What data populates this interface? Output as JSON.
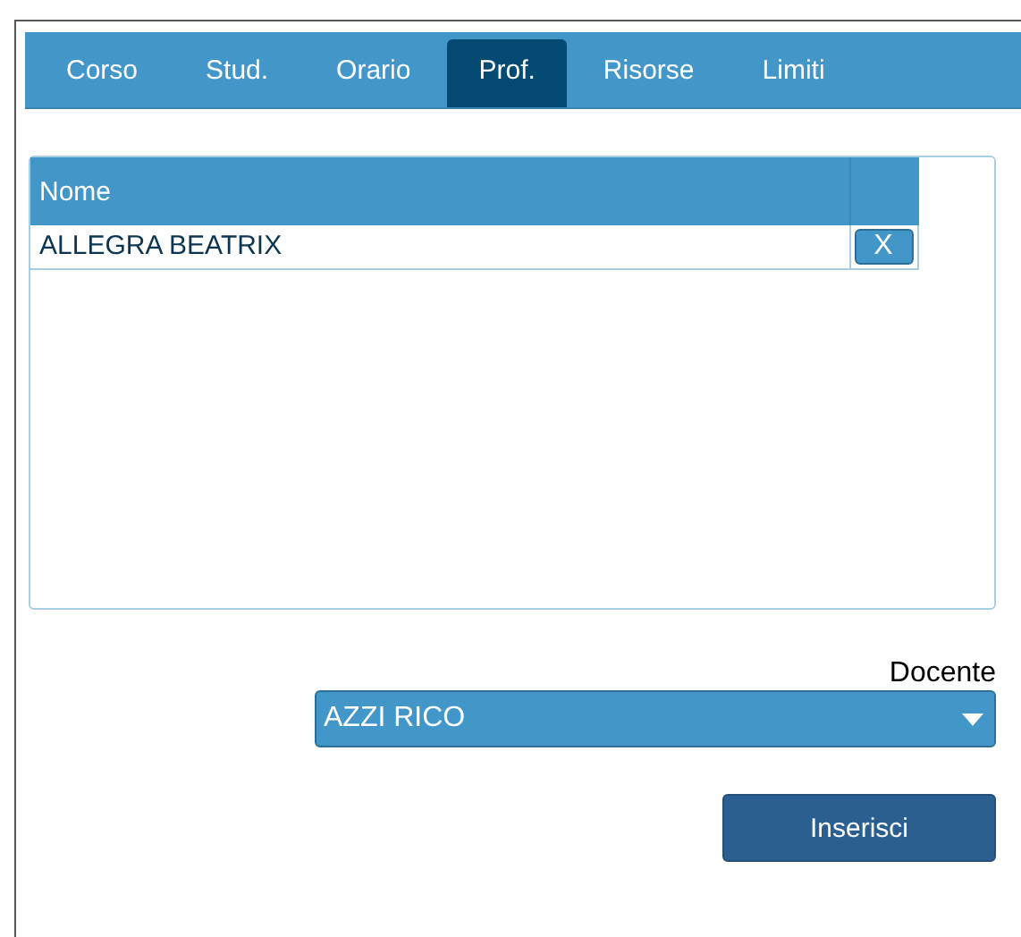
{
  "tabs": [
    {
      "label": "Corso",
      "selected": false
    },
    {
      "label": "Stud.",
      "selected": false
    },
    {
      "label": "Orario",
      "selected": false
    },
    {
      "label": "Prof.",
      "selected": true
    },
    {
      "label": "Risorse",
      "selected": false
    },
    {
      "label": "Limiti",
      "selected": false
    }
  ],
  "table": {
    "columns": [
      "Nome"
    ],
    "rows": [
      {
        "name": "ALLEGRA BEATRIX",
        "remove": "X"
      }
    ]
  },
  "docente": {
    "label": "Docente",
    "value": "AZZI RICO"
  },
  "buttons": [
    "Inserisci"
  ]
}
